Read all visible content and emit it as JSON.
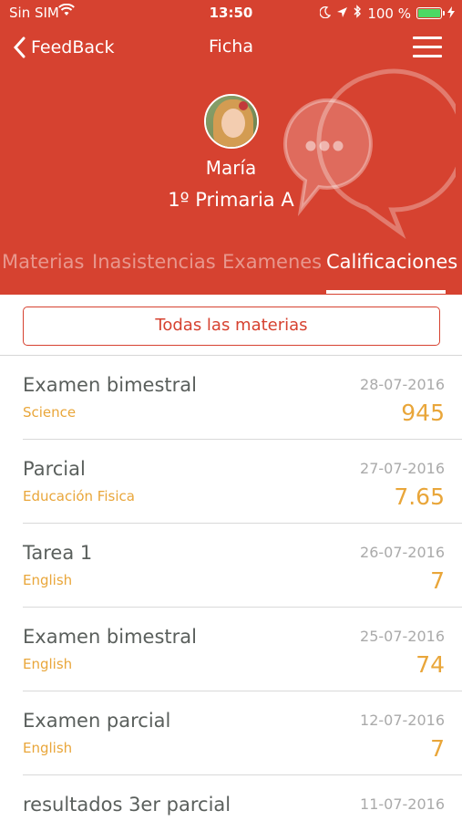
{
  "status_bar": {
    "carrier": "Sin SIM",
    "time": "13:50",
    "battery": "100 %",
    "battery_level": 1.0,
    "battery_color": "#4cd964"
  },
  "nav": {
    "back_label": "FeedBack",
    "title": "Ficha",
    "back_icon": "chevron-left-icon",
    "menu_icon": "hamburger-menu-icon"
  },
  "profile": {
    "name": "María",
    "class": "1º Primaria A"
  },
  "tabs": [
    {
      "label": "Materias",
      "active": false
    },
    {
      "label": "Inasistencias",
      "active": false
    },
    {
      "label": "Examenes",
      "active": false
    },
    {
      "label": "Calificaciones",
      "active": true
    }
  ],
  "filter": {
    "label": "Todas las materias"
  },
  "colors": {
    "brand": "#d64230",
    "accent": "#e9a63a",
    "title_text": "#5a5f5c",
    "date_text": "#aaaaaa"
  },
  "grades": [
    {
      "title": "Examen bimestral",
      "subject": "Science",
      "date": "28-07-2016",
      "grade": "945"
    },
    {
      "title": "Parcial",
      "subject": "Educación Fisica",
      "date": "27-07-2016",
      "grade": "7.65"
    },
    {
      "title": "Tarea 1",
      "subject": "English",
      "date": "26-07-2016",
      "grade": "7"
    },
    {
      "title": "Examen bimestral",
      "subject": "English",
      "date": "25-07-2016",
      "grade": "74"
    },
    {
      "title": "Examen parcial",
      "subject": "English",
      "date": "12-07-2016",
      "grade": "7"
    },
    {
      "title": "resultados 3er parcial",
      "subject": "",
      "date": "11-07-2016",
      "grade": ""
    }
  ]
}
